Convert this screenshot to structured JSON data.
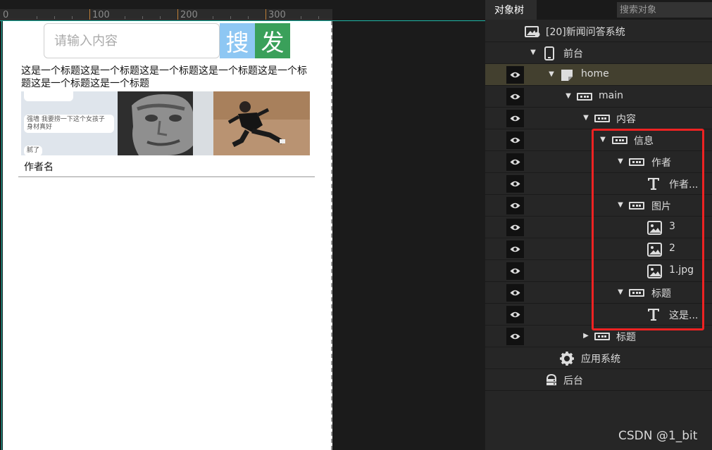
{
  "ruler": {
    "ticks": [
      "0",
      "100",
      "200",
      "300"
    ]
  },
  "preview": {
    "search_placeholder": "请输入内容",
    "search_button": "搜",
    "post_button": "发",
    "news_title": "这是一个标题这是一个标题这是一个标题这是一个标题这是一个标题这是一个标题这是一个标题",
    "chat_lines": [
      "强墙 我要捞一下这个女孩子 身材真好",
      "腻了"
    ],
    "author": "作者名"
  },
  "panel": {
    "tab": "对象树",
    "search_placeholder": "搜索对象",
    "tree": [
      {
        "label": "[20]新闻问答系统",
        "icon": "project-icon",
        "eye": false,
        "arrow": "none"
      },
      {
        "label": "前台",
        "icon": "phone-icon",
        "eye": false,
        "arrow": "down"
      },
      {
        "label": "home",
        "icon": "page-icon",
        "eye": true,
        "arrow": "down",
        "selected": true
      },
      {
        "label": "main",
        "icon": "container-icon",
        "eye": true,
        "arrow": "down"
      },
      {
        "label": "内容",
        "icon": "container-icon",
        "eye": true,
        "arrow": "down"
      },
      {
        "label": "信息",
        "icon": "container-icon",
        "eye": true,
        "arrow": "down"
      },
      {
        "label": "作者",
        "icon": "container-icon",
        "eye": true,
        "arrow": "down"
      },
      {
        "label": "作者...",
        "icon": "text-icon",
        "eye": true,
        "arrow": "none"
      },
      {
        "label": "图片",
        "icon": "container-icon",
        "eye": true,
        "arrow": "down"
      },
      {
        "label": "3",
        "icon": "image-icon",
        "eye": true,
        "arrow": "none"
      },
      {
        "label": "2",
        "icon": "image-icon",
        "eye": true,
        "arrow": "none"
      },
      {
        "label": "1.jpg",
        "icon": "image-icon",
        "eye": true,
        "arrow": "none"
      },
      {
        "label": "标题",
        "icon": "container-icon",
        "eye": true,
        "arrow": "down"
      },
      {
        "label": "这是...",
        "icon": "text-icon",
        "eye": true,
        "arrow": "none"
      },
      {
        "label": "标题",
        "icon": "container-icon",
        "eye": true,
        "arrow": "right"
      },
      {
        "label": "应用系统",
        "icon": "gear-icon",
        "eye": false,
        "arrow": "none"
      },
      {
        "label": "后台",
        "icon": "server-icon",
        "eye": false,
        "arrow": "none"
      }
    ]
  },
  "watermark": "CSDN @1_bit"
}
